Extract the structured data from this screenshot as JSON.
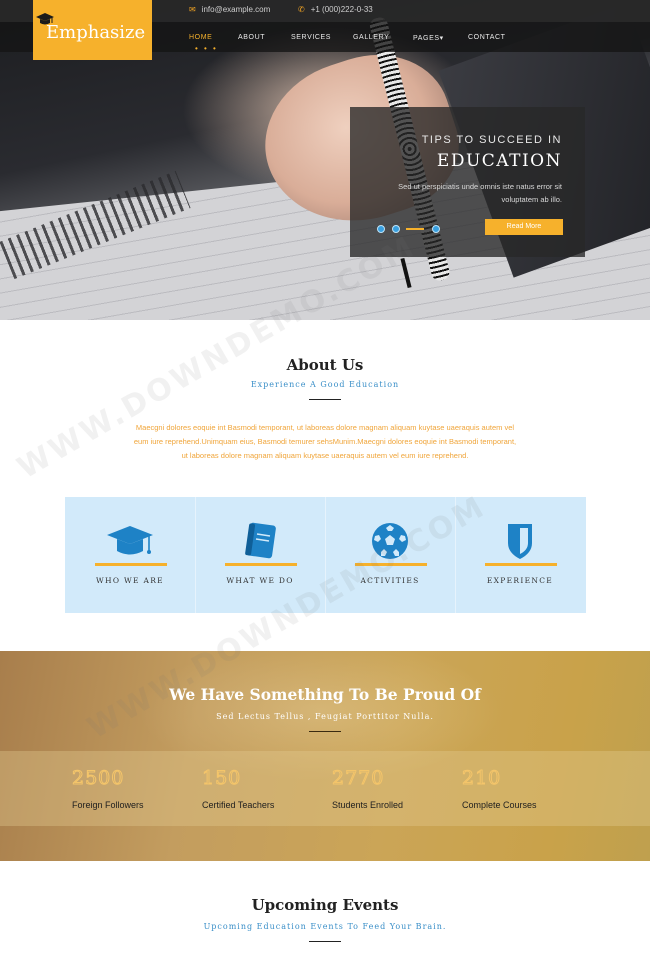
{
  "topbar": {
    "email": "info@example.com",
    "phone": "+1 (000)222-0-33",
    "email_icon": "envelope-icon",
    "phone_icon": "phone-icon"
  },
  "logo": {
    "text": "Emphasize",
    "icon": "graduation-cap-icon"
  },
  "nav": {
    "items": [
      {
        "label": "HOME",
        "active": true
      },
      {
        "label": "ABOUT",
        "active": false
      },
      {
        "label": "SERVICES",
        "active": false
      },
      {
        "label": "GALLERY",
        "active": false
      },
      {
        "label": "PAGES",
        "active": false,
        "has_dropdown": true
      },
      {
        "label": "CONTACT",
        "active": false
      }
    ],
    "active_indicator": "• • •",
    "dropdown_caret": "▾"
  },
  "slider": {
    "kicker": "TIPS TO SUCCEED IN",
    "title": "EDUCATION",
    "text": "Sed ut perspiciatis unde omnis iste natus error sit voluptatem ab illo.",
    "button_label": "Read More",
    "dot_count": 3,
    "active_dot": 2
  },
  "about": {
    "title": "About Us",
    "subtitle": "Experience A Good Education",
    "body": "Maecgni dolores eoquie int Basmodi temporant, ut laboreas dolore magnam aliquam kuytase uaeraquis autem vel eum iure reprehend.Unimquam eius, Basmodi temurer sehsMunim.Maecgni dolores eoquie int Basmodi temporant, ut laboreas dolore magnam aliquam kuytase uaeraquis autem vel eum iure reprehend.",
    "features": [
      {
        "label": "WHO WE ARE",
        "icon": "graduation-cap-icon"
      },
      {
        "label": "WHAT WE DO",
        "icon": "book-icon"
      },
      {
        "label": "ACTIVITIES",
        "icon": "soccer-ball-icon"
      },
      {
        "label": "EXPERIENCE",
        "icon": "shield-icon"
      }
    ]
  },
  "proud": {
    "title": "We Have Something To Be Proud Of",
    "subtitle": "Sed Lectus Tellus , Feugiat Porttitor Nulla.",
    "stats": [
      {
        "value": "2500",
        "label": "Foreign Followers"
      },
      {
        "value": "150",
        "label": "Certified Teachers"
      },
      {
        "value": "2770",
        "label": "Students Enrolled"
      },
      {
        "value": "210",
        "label": "Complete Courses"
      }
    ]
  },
  "events": {
    "title": "Upcoming Events",
    "subtitle": "Upcoming Education Events To Feed Your Brain."
  },
  "colors": {
    "accent": "#f6b12c",
    "link_blue": "#3a8fc8",
    "feature_bg": "#d2eafa",
    "icon_blue": "#1e82c6"
  }
}
